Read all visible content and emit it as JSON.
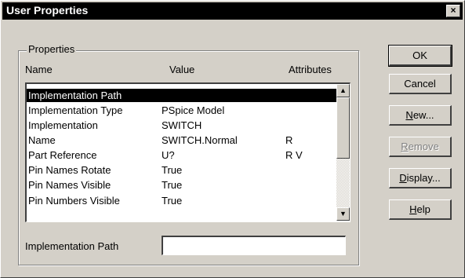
{
  "window": {
    "title": "User Properties",
    "close_label": "×"
  },
  "group": {
    "label": "Properties"
  },
  "columns": {
    "name": "Name",
    "value": "Value",
    "attributes": "Attributes"
  },
  "rows": [
    {
      "name": "Implementation Path",
      "value": "",
      "attr": "",
      "selected": true
    },
    {
      "name": "Implementation Type",
      "value": "PSpice Model",
      "attr": ""
    },
    {
      "name": "Implementation",
      "value": "SWITCH",
      "attr": ""
    },
    {
      "name": "Name",
      "value": "SWITCH.Normal",
      "attr": "R"
    },
    {
      "name": "Part Reference",
      "value": "U?",
      "attr": "R V"
    },
    {
      "name": "Pin Names Rotate",
      "value": "True",
      "attr": ""
    },
    {
      "name": "Pin Names Visible",
      "value": "True",
      "attr": ""
    },
    {
      "name": "Pin Numbers Visible",
      "value": "True",
      "attr": ""
    }
  ],
  "scroll": {
    "up": "▲",
    "down": "▼"
  },
  "edit": {
    "label": "Implementation Path",
    "value": ""
  },
  "buttons": {
    "ok": {
      "label": "OK"
    },
    "cancel": {
      "label": "Cancel"
    },
    "new": {
      "key": "N",
      "rest": "ew..."
    },
    "remove": {
      "key": "R",
      "rest": "emove",
      "disabled": true
    },
    "display": {
      "key": "D",
      "rest": "isplay..."
    },
    "help": {
      "key": "H",
      "rest": "elp"
    }
  }
}
